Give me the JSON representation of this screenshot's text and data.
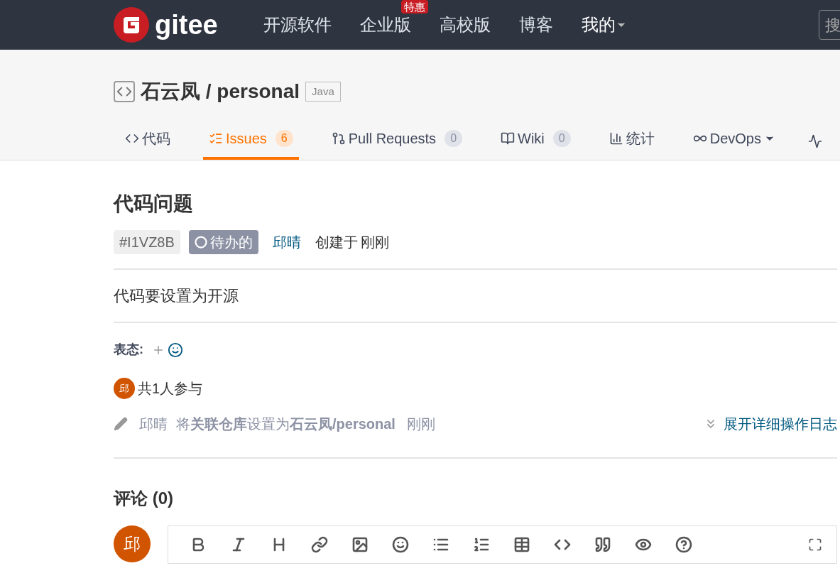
{
  "nav": {
    "logo_text": "gitee",
    "items": [
      {
        "label": "开源软件"
      },
      {
        "label": "企业版",
        "badge": "特惠"
      },
      {
        "label": "高校版"
      },
      {
        "label": "博客"
      }
    ],
    "user_menu": "我的",
    "search_placeholder": "搜"
  },
  "repo": {
    "path": "石云凤 / personal",
    "language": "Java"
  },
  "tabs": [
    {
      "label": "代码",
      "selected": false
    },
    {
      "label": "Issues",
      "count": "6",
      "selected": true
    },
    {
      "label": "Pull Requests",
      "count": "0",
      "selected": false
    },
    {
      "label": "Wiki",
      "count": "0",
      "selected": false
    },
    {
      "label": "统计",
      "selected": false
    },
    {
      "label": "DevOps",
      "dropdown": true,
      "selected": false
    }
  ],
  "issue": {
    "title": "代码问题",
    "id": "#I1VZ8B",
    "status": "待办的",
    "author": "邱晴",
    "created": "创建于",
    "time": "刚刚",
    "description": "代码要设置为开源"
  },
  "reactions": {
    "label": "表态:"
  },
  "participants": {
    "avatar": "邱",
    "text": "共1人参与"
  },
  "log": {
    "user": "邱晴",
    "action": "将**关联仓库**设置为**石云凤/personal**",
    "time": "刚刚",
    "expand": "展开详细操作日志"
  },
  "comments": {
    "title": "评论 (0)",
    "avatar": "邱"
  }
}
